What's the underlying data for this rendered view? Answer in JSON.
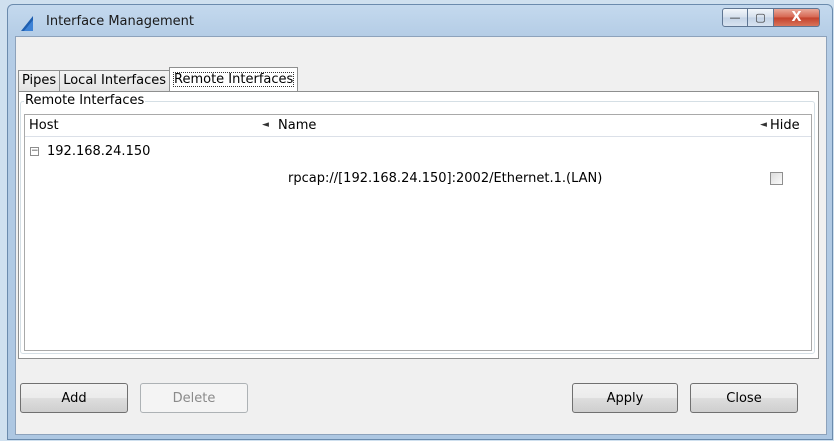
{
  "window": {
    "title": "Interface Management",
    "minimize_label": "—",
    "maximize_label": "▢",
    "close_label": "X"
  },
  "tabs": [
    {
      "label": "Pipes"
    },
    {
      "label": "Local Interfaces"
    },
    {
      "label": "Remote Interfaces",
      "active": true
    }
  ],
  "group": {
    "title": "Remote Interfaces"
  },
  "table": {
    "columns": {
      "host": "Host",
      "name": "Name",
      "hide": "Hide"
    },
    "sort_glyph": "◄",
    "rows": [
      {
        "host": "192.168.24.150",
        "expander": "−",
        "name": "rpcap://[192.168.24.150]:2002/Ethernet.1.(LAN)",
        "hide": false
      }
    ]
  },
  "buttons": {
    "add": "Add",
    "delete": "Delete",
    "apply": "Apply",
    "close": "Close"
  }
}
